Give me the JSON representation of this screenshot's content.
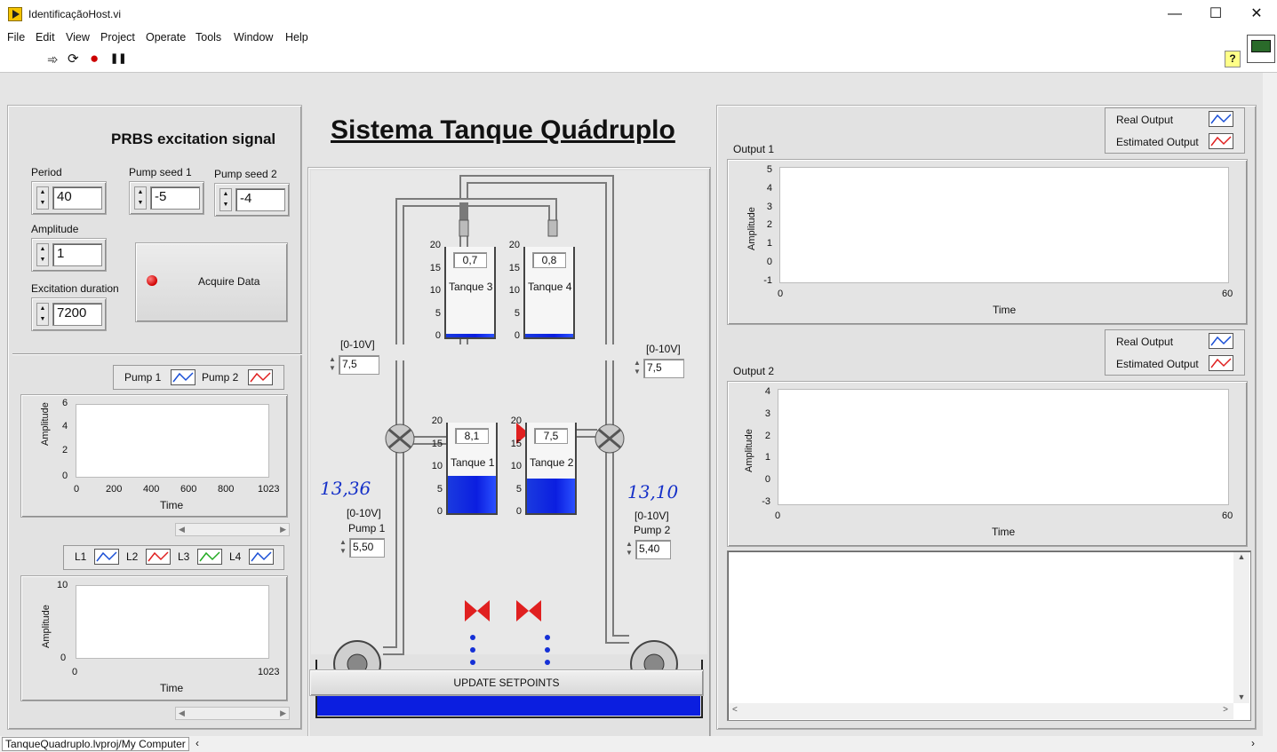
{
  "window": {
    "title": "IdentificaçãoHost.vi",
    "min": "—",
    "max": "☐",
    "close": "✕"
  },
  "menu": [
    "File",
    "Edit",
    "View",
    "Project",
    "Operate",
    "Tools",
    "Window",
    "Help"
  ],
  "toolbar": {
    "run": "➾",
    "run_cont": "⟳",
    "abort": "●",
    "pause": "❚❚",
    "help": "?"
  },
  "status_bar": {
    "path": "TanqueQuadruplo.lvproj/My Computer"
  },
  "prbs": {
    "title": "PRBS excitation signal",
    "period": {
      "label": "Period",
      "value": "40"
    },
    "seed1": {
      "label": "Pump seed 1",
      "value": "-5"
    },
    "seed2": {
      "label": "Pump seed 2",
      "value": "-4"
    },
    "amplitude": {
      "label": "Amplitude",
      "value": "1"
    },
    "duration": {
      "label": "Excitation duration",
      "value": "7200"
    },
    "acquire": "Acquire Data"
  },
  "pump_chart": {
    "legend": [
      {
        "name": "Pump 1",
        "color": "#1a4fd6"
      },
      {
        "name": "Pump 2",
        "color": "#e02020"
      }
    ],
    "ylabel": "Amplitude",
    "xlabel": "Time",
    "yticks": [
      "6",
      "4",
      "2",
      "0"
    ],
    "xticks": [
      "0",
      "200",
      "400",
      "600",
      "800",
      "1023"
    ]
  },
  "level_chart": {
    "legend": [
      {
        "name": "L1",
        "color": "#1a4fd6"
      },
      {
        "name": "L2",
        "color": "#e02020"
      },
      {
        "name": "L3",
        "color": "#22aa22"
      },
      {
        "name": "L4",
        "color": "#1a4fd6"
      }
    ],
    "ylabel": "Amplitude",
    "xlabel": "Time",
    "yticks": [
      "10",
      "0"
    ],
    "xticks": [
      "0",
      "1023"
    ]
  },
  "system": {
    "title": "Sistema Tanque Quádruplo",
    "tanks": [
      {
        "name": "Tanque 3",
        "value": "0,7",
        "level": 0.035
      },
      {
        "name": "Tanque 4",
        "value": "0,8",
        "level": 0.04
      },
      {
        "name": "Tanque 1",
        "value": "8,1",
        "level": 0.405
      },
      {
        "name": "Tanque 2",
        "value": "7,5",
        "level": 0.375
      }
    ],
    "tank_ticks": [
      "20",
      "15",
      "10",
      "5",
      "0"
    ],
    "valve_left": {
      "range": "[0-10V]",
      "value": "7,5"
    },
    "valve_right": {
      "range": "[0-10V]",
      "value": "7,5"
    },
    "pump1": {
      "range": "[0-10V]",
      "label": "Pump 1",
      "value": "5,50",
      "handwritten": "13,36"
    },
    "pump2": {
      "range": "[0-10V]",
      "label": "Pump 2",
      "value": "5,40",
      "handwritten": "13,10"
    },
    "update": "UPDATE SETPOINTS",
    "colors": {
      "water": "#0b1ee0",
      "pipe": "#d8d8d8",
      "valve": "#e02020"
    }
  },
  "output1": {
    "title": "Output 1",
    "legend": [
      {
        "name": "Real Output",
        "color": "#1a4fd6"
      },
      {
        "name": "Estimated Output",
        "color": "#e02020"
      }
    ],
    "ylabel": "Amplitude",
    "xlabel": "Time",
    "yticks": [
      "5",
      "4",
      "3",
      "2",
      "1",
      "0",
      "-1"
    ],
    "xticks": [
      "0",
      "60"
    ]
  },
  "output2": {
    "title": "Output 2",
    "legend": [
      {
        "name": "Real Output",
        "color": "#1a4fd6"
      },
      {
        "name": "Estimated Output",
        "color": "#e02020"
      }
    ],
    "ylabel": "Amplitude",
    "xlabel": "Time",
    "yticks": [
      "4",
      "3",
      "2",
      "1",
      "0",
      "-3"
    ],
    "xticks": [
      "0",
      "60"
    ]
  },
  "log": {
    "text": ""
  }
}
